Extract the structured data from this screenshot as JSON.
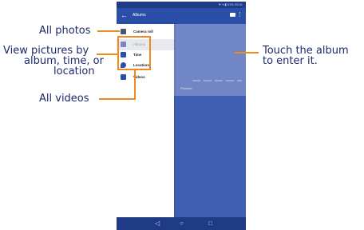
{
  "annotations": {
    "all_photos": "All photos",
    "view_by_line1": "View pictures by",
    "view_by_line2": "album, time, or",
    "view_by_line3": "location",
    "all_videos": "All videos",
    "touch_line1": "Touch the album",
    "touch_line2": "to enter it."
  },
  "status_bar": {
    "text": "▼ ▾ ▮ 61% 09:41"
  },
  "app_bar": {
    "back_icon": "arrow-back-icon",
    "title": "Albums",
    "camera_icon": "camera-icon",
    "more_icon": "more-vert-icon"
  },
  "drawer": {
    "items": [
      {
        "label": "Camera roll",
        "icon": "camera-icon"
      },
      {
        "label": "Albums",
        "icon": "album-icon",
        "selected": true
      },
      {
        "label": "Time",
        "icon": "calendar-icon"
      },
      {
        "label": "Locations",
        "icon": "location-pin-icon"
      },
      {
        "label": "Videos",
        "icon": "video-icon"
      }
    ]
  },
  "album": {
    "name": "Pictures"
  },
  "nav_bar": {
    "back": "◁",
    "home": "○",
    "recents": "□"
  },
  "colors": {
    "accent": "#f08a1c",
    "appbar": "#2b4ea8",
    "callout_text": "#1d2a6e"
  }
}
